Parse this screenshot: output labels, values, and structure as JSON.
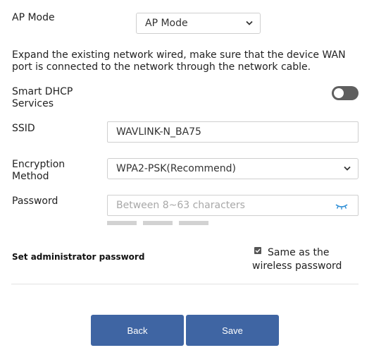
{
  "ap_mode": {
    "label": "AP Mode",
    "selected": "AP Mode"
  },
  "description": {
    "line1": "Expand the existing network wired, make sure that the device WAN",
    "line2": "port is connected to the network through the network cable."
  },
  "dhcp": {
    "label_line1": "Smart DHCP",
    "label_line2": "Services",
    "enabled": false
  },
  "ssid": {
    "label": "SSID",
    "value": "WAVLINK-N_BA75"
  },
  "encryption": {
    "label_line1": "Encryption",
    "label_line2": "Method",
    "selected": "WPA2-PSK(Recommend)"
  },
  "password": {
    "label": "Password",
    "placeholder": "Between 8~63 characters",
    "toggle_icon": "eye-closed-icon",
    "strength_level": 0
  },
  "admin": {
    "label": "Set administrator password",
    "same_line1": "Same as the",
    "same_line2": "wireless password",
    "same_checked": true
  },
  "buttons": {
    "back": "Back",
    "save": "Save"
  },
  "colors": {
    "primary": "#3f65a3",
    "toggle_off": "#5f5f5f",
    "eye_icon": "#2f8fd6"
  }
}
